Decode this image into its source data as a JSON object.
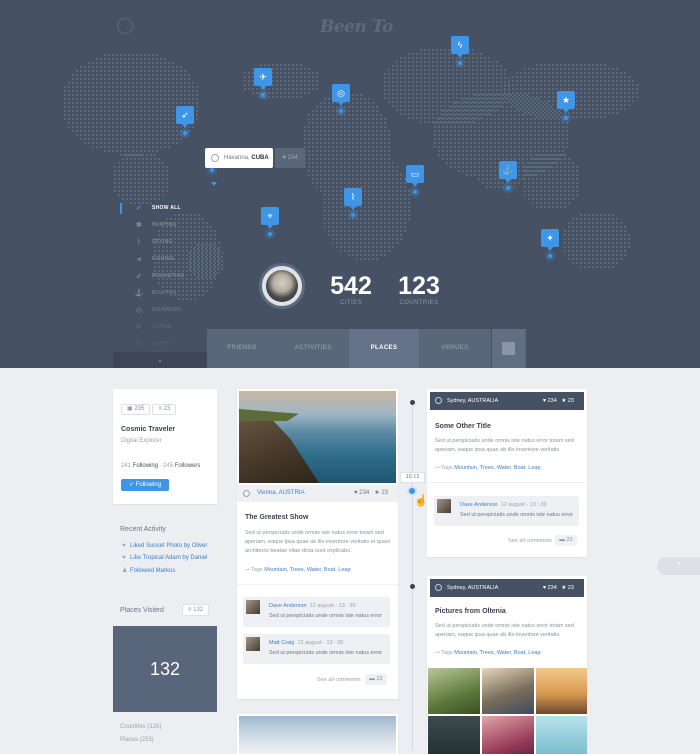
{
  "brand": {
    "name": "Been To"
  },
  "map": {
    "popup": {
      "city": "Havanna,",
      "country": "CUBA",
      "favs": "234"
    },
    "pins": [
      {
        "name": "pin-flight",
        "glyph": "✈"
      },
      {
        "name": "pin-rocket",
        "glyph": "➶"
      },
      {
        "name": "pin-lifebuoy",
        "glyph": "◎"
      },
      {
        "name": "pin-lightning",
        "glyph": "ϟ"
      },
      {
        "name": "pin-star",
        "glyph": "★"
      },
      {
        "name": "pin-fishing",
        "glyph": "⌖"
      },
      {
        "name": "pin-binoculars",
        "glyph": "⌇"
      },
      {
        "name": "pin-anchor",
        "glyph": "⚓"
      },
      {
        "name": "pin-camera",
        "glyph": "▭"
      },
      {
        "name": "pin-mapleleaf",
        "glyph": "✦"
      }
    ]
  },
  "filters": [
    {
      "label": "SHOW ALL",
      "icon": "✓",
      "active": true
    },
    {
      "label": "HUNTING",
      "icon": "✱"
    },
    {
      "label": "SPYING",
      "icon": "⌇"
    },
    {
      "label": "FISHING",
      "icon": "◂"
    },
    {
      "label": "ROCKETING",
      "icon": "➶"
    },
    {
      "label": "BOATING",
      "icon": "⚓"
    },
    {
      "label": "SWIMMING",
      "icon": "◎"
    },
    {
      "label": "FLYING",
      "icon": "✈"
    },
    {
      "label": "DIVING",
      "icon": "✦"
    }
  ],
  "stats": {
    "cities": "542",
    "cities_label": "CITIES",
    "countries": "123",
    "countries_label": "COUNTRIES"
  },
  "tabs": {
    "friends": "FRIENDS",
    "activities": "ACTIVITIES",
    "places": "PLACES",
    "venues": "VENUES"
  },
  "profile": {
    "photos": "235",
    "pins": "23",
    "name": "Cosmic Traveler",
    "title": "Digital Explorer",
    "following_count": "241",
    "following_label": "Following",
    "followers_count": "245",
    "followers_label": "Followers",
    "button": "Following"
  },
  "recent": {
    "header": "Recent Activity",
    "items": [
      "Liked Sunset Photo by Oliver",
      "Like Tropical Adam by Daniel",
      "Followed Markus"
    ]
  },
  "places": {
    "header": "Places Visited",
    "pin_count": "132",
    "count": "132",
    "countries": "Countries (126)",
    "places": "Places (253)"
  },
  "post": {
    "place": "Vienna, AUSTRIA",
    "likes": "234",
    "stars": "23",
    "title": "The Greatest Show",
    "body": "Sed ut perspiciatis unde omnis iste natus error totam sed aperiam, eaque ipsa quae ab illo inventore veritatis et quasi architecto beatae vitae dicta sunt explicabo.",
    "tags_label": "Tags",
    "tags": "Mountain, Trees, Water, Boat, Leap",
    "comments": [
      {
        "name": "Dave Anderson",
        "date": "12 august - 13 : 30",
        "text": "Sed ut perspiciatis unde omnis iste natus error"
      },
      {
        "name": "Matt Craig",
        "date": "12 august - 13 : 30",
        "text": "Sed ut perspiciatis unde omnis iste natus error"
      }
    ],
    "see_all": "See all comments",
    "comment_count": "23"
  },
  "timeline": {
    "date": "10.12"
  },
  "card3": {
    "place": "Sydney, AUSTRALIA",
    "likes": "234",
    "stars": "23",
    "title": "Some Other Title",
    "body": "Sed ut perspiciatis unde omnis iste natus error totam sed aperiam, eaque ipsa quae ab illo inventore veritatis.",
    "tags_label": "Tags",
    "tags": "Mountain, Trees, Water, Boat, Leap",
    "comment": {
      "name": "Dave Anderson",
      "date": "12 august - 13 : 30",
      "text": "Sed ut perspiciatis unde omnis iste natus error"
    },
    "see_all": "See all comments",
    "comment_count": "23"
  },
  "card4": {
    "place": "Sydney, AUSTRALIA",
    "likes": "234",
    "stars": "23",
    "title": "Pictures from Oltenia",
    "body": "Sed ut perspiciatis unde omnis iste natus error totam sed aperiam, eaque ipsa quae ab illo inventore veritatis.",
    "tags_label": "Tags",
    "tags": "Mountain, Trees, Water, Boat, Leap"
  },
  "colors": {
    "accent": "#3f96e6",
    "header": "#465163",
    "background": "#eceef1"
  }
}
